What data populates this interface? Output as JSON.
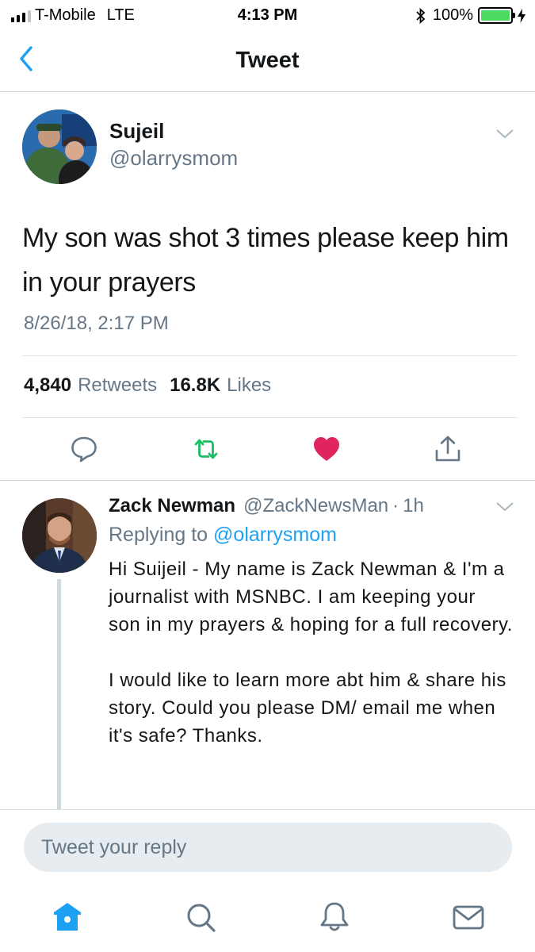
{
  "status": {
    "carrier": "T-Mobile",
    "network": "LTE",
    "time": "4:13 PM",
    "battery": "100%",
    "signal_bars_filled": 3,
    "signal_bars_total": 4
  },
  "nav": {
    "title": "Tweet",
    "back_icon": "chevron-left-icon"
  },
  "tweet": {
    "name": "Sujeil",
    "handle": "@olarrysmom",
    "text": "My son was shot 3 times please keep him in your prayers",
    "timestamp": "8/26/18, 2:17 PM",
    "retweets_count": "4,840",
    "retweets_label": "Retweets",
    "likes_count": "16.8K",
    "likes_label": "Likes",
    "liked": true
  },
  "reply": {
    "name": "Zack Newman",
    "handle": "@ZackNewsMan",
    "separator": "·",
    "time": "1h",
    "replying_prefix": "Replying to",
    "replying_to": "@olarrysmom",
    "text": "Hi Suijeil - My name is Zack Newman & I'm a journalist with MSNBC. I am keeping your son in my prayers & hoping for a full recovery.\n\nI would like to learn more abt him & share his story. Could you please DM/ email me when it's safe? Thanks."
  },
  "composer": {
    "placeholder": "Tweet your reply"
  },
  "tabbar": {
    "items": [
      "home-icon",
      "search-icon",
      "bell-icon",
      "mail-icon"
    ],
    "active": "home-icon"
  },
  "colors": {
    "accent": "#1da1f2",
    "like": "#e0245e",
    "retweet": "#17bf63",
    "secondary_text": "#657786",
    "battery": "#4cd964"
  }
}
